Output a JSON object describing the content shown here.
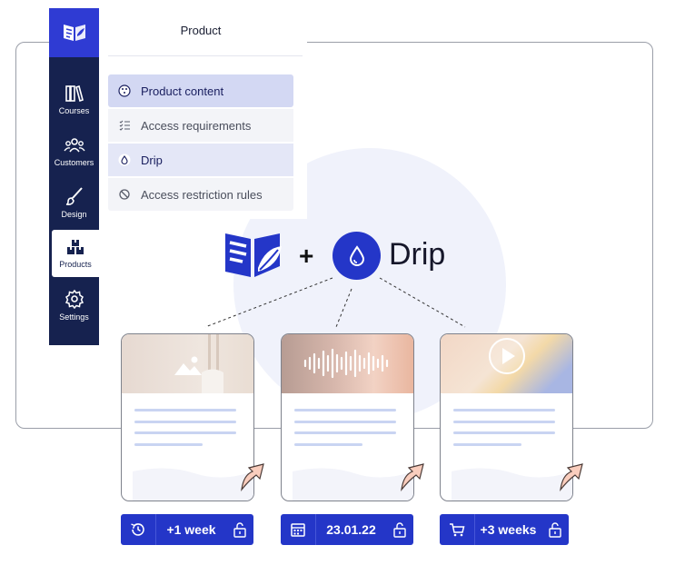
{
  "sidebar": {
    "items": [
      {
        "label": "Courses",
        "icon": "books-icon"
      },
      {
        "label": "Customers",
        "icon": "users-icon"
      },
      {
        "label": "Design",
        "icon": "brush-icon"
      },
      {
        "label": "Products",
        "icon": "boxes-icon",
        "active": true
      },
      {
        "label": "Settings",
        "icon": "gear-icon"
      }
    ]
  },
  "panel": {
    "title": "Product",
    "menu": [
      {
        "label": "Product content",
        "icon": "palette-icon"
      },
      {
        "label": "Access requirements",
        "icon": "checklist-icon"
      },
      {
        "label": "Drip",
        "icon": "droplet-icon"
      },
      {
        "label": "Access restriction rules",
        "icon": "ban-icon"
      }
    ]
  },
  "center": {
    "plus": "+",
    "drip_label": "Drip"
  },
  "cards": [
    {
      "media": "image",
      "icon": "image-icon"
    },
    {
      "media": "audio",
      "icon": "waveform-icon"
    },
    {
      "media": "video",
      "icon": "play-icon"
    }
  ],
  "badges": [
    {
      "text": "+1 week",
      "icon": "history-icon"
    },
    {
      "text": "23.01.22",
      "icon": "calendar-icon"
    },
    {
      "text": "+3 weeks",
      "icon": "cart-icon"
    }
  ],
  "colors": {
    "primary": "#2436c8",
    "sidebar": "#16224f",
    "accent": "#f4a58a"
  }
}
